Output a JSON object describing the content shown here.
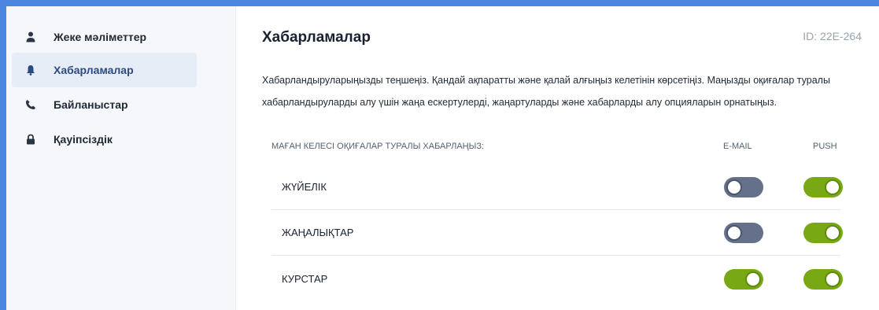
{
  "sidebar": {
    "items": [
      {
        "label": "Жеке мәліметтер",
        "icon": "user-icon",
        "active": false
      },
      {
        "label": "Хабарламалар",
        "icon": "bell-icon",
        "active": true
      },
      {
        "label": "Байланыстар",
        "icon": "phone-icon",
        "active": false
      },
      {
        "label": "Қауіпсіздік",
        "icon": "lock-icon",
        "active": false
      }
    ]
  },
  "main": {
    "title": "Хабарламалар",
    "id_label": "ID: 22E-264",
    "description": "Хабарландыруларыңызды теңшеңіз. Қандай ақпаратты және қалай алғыңыз келетінін көрсетіңіз. Маңызды оқиғалар туралы хабарландыруларды алу үшін жаңа ескертулерді, жаңартуларды және хабарларды алу опцияларын орнатыңыз.",
    "table": {
      "headers": {
        "events": "МАҒАН КЕЛЕСІ ОҚИҒАЛАР ТУРАЛЫ ХАБАРЛАҢЫЗ:",
        "email": "E-MAIL",
        "push": "PUSH"
      },
      "rows": [
        {
          "label": "ЖҮЙЕЛІК",
          "email": false,
          "push": true
        },
        {
          "label": "ЖАҢАЛЫҚТАР",
          "email": false,
          "push": true
        },
        {
          "label": "КУРСТАР",
          "email": true,
          "push": true
        }
      ]
    }
  },
  "colors": {
    "accent_frame": "#4d86e0",
    "toggle_on": "#78a814",
    "toggle_off": "#65718a",
    "active_nav_bg": "#e7edf6"
  }
}
